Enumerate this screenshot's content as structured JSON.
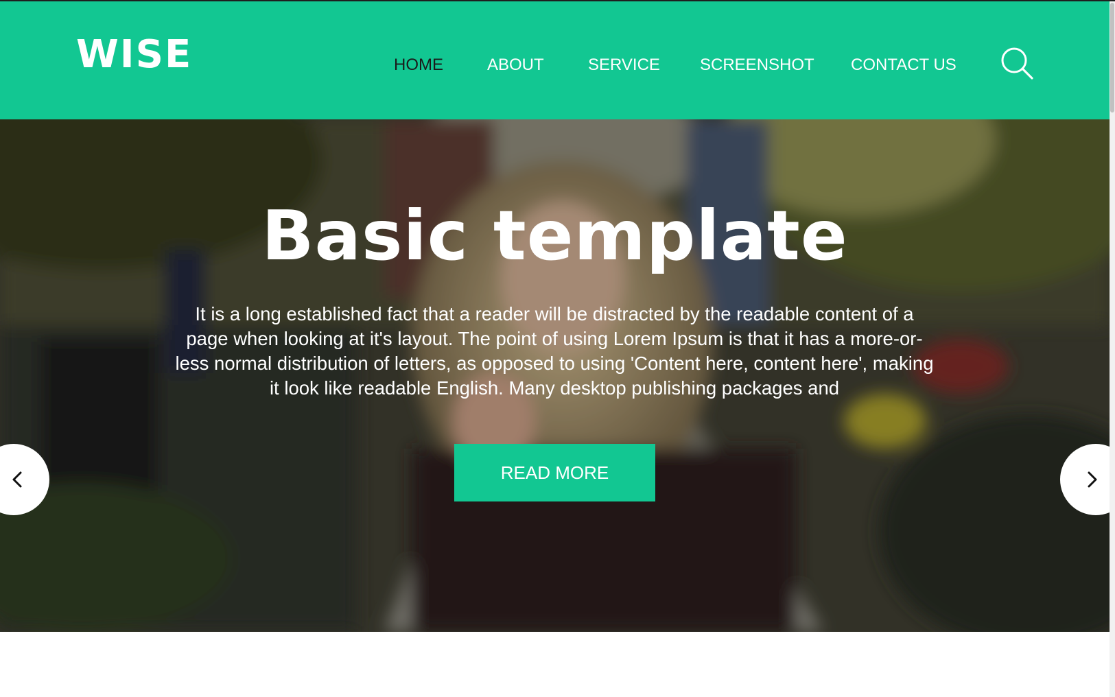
{
  "header": {
    "logo": "WISE",
    "nav": [
      {
        "label": "HOME",
        "active": true
      },
      {
        "label": "ABOUT",
        "active": false
      },
      {
        "label": "SERVICE",
        "active": false
      },
      {
        "label": "SCREENSHOT",
        "active": false
      },
      {
        "label": "CONTACT US",
        "active": false
      }
    ],
    "search_icon": "search-icon"
  },
  "hero": {
    "title": "Basic template",
    "text_lines": [
      "It is a long established fact that a reader will be distracted by the readable content of a",
      "page when looking at it's layout. The point of using Lorem Ipsum is that it has a more-or-",
      "less normal distribution of letters, as opposed to using 'Content here, content here', making",
      "it look like readable English. Many desktop publishing packages and"
    ],
    "button_label": "READ MORE",
    "prev_icon": "chevron-left-icon",
    "next_icon": "chevron-right-icon"
  },
  "colors": {
    "accent": "#12c792",
    "active_nav": "#1b1b1b",
    "text_light": "#ffffff"
  }
}
